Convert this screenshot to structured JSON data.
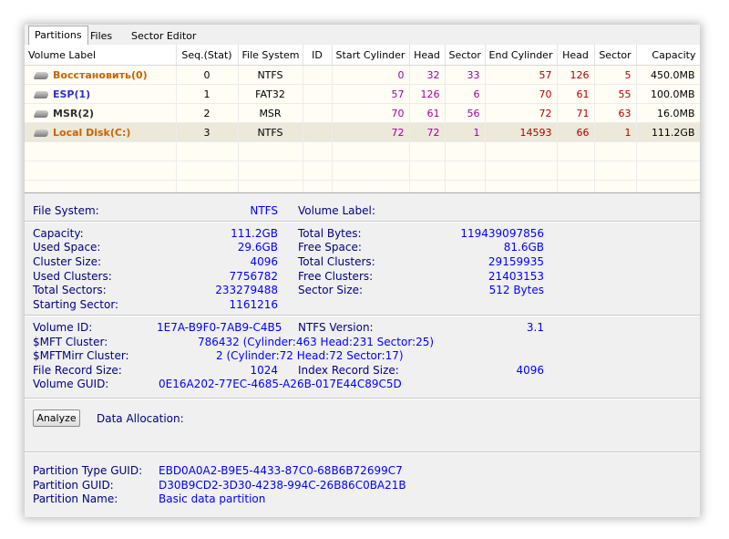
{
  "tabs": [
    "Partitions",
    "Files",
    "Sector Editor"
  ],
  "columns": [
    "Volume Label",
    "Seq.(Stat)",
    "File System",
    "ID",
    "Start Cylinder",
    "Head",
    "Sector",
    "End Cylinder",
    "Head",
    "Sector",
    "Capacity"
  ],
  "rows": [
    {
      "label": "Восстановить(0)",
      "seq": "0",
      "fs": "NTFS",
      "id": "",
      "start_cyl": "0",
      "head1": "32",
      "sector1": "33",
      "end_cyl": "57",
      "head2": "126",
      "sector2": "5",
      "capacity": "450.0MB"
    },
    {
      "label": "ESP(1)",
      "seq": "1",
      "fs": "FAT32",
      "id": "",
      "start_cyl": "57",
      "head1": "126",
      "sector1": "6",
      "end_cyl": "70",
      "head2": "61",
      "sector2": "55",
      "capacity": "100.0MB"
    },
    {
      "label": "MSR(2)",
      "seq": "2",
      "fs": "MSR",
      "id": "",
      "start_cyl": "70",
      "head1": "61",
      "sector1": "56",
      "end_cyl": "72",
      "head2": "71",
      "sector2": "63",
      "capacity": "16.0MB"
    },
    {
      "label": "Local Disk(C:)",
      "seq": "3",
      "fs": "NTFS",
      "id": "",
      "start_cyl": "72",
      "head1": "72",
      "sector1": "1",
      "end_cyl": "14593",
      "head2": "66",
      "sector2": "1",
      "capacity": "111.2GB"
    }
  ],
  "info": {
    "file_system_label": "File System:",
    "file_system": "NTFS",
    "volume_label_label": "Volume Label:",
    "capacity_label": "Capacity:",
    "capacity": "111.2GB",
    "used_space_label": "Used Space:",
    "used_space": "29.6GB",
    "cluster_size_label": "Cluster Size:",
    "cluster_size": "4096",
    "used_clusters_label": "Used Clusters:",
    "used_clusters": "7756782",
    "total_sectors_label": "Total Sectors:",
    "total_sectors": "233279488",
    "starting_sector_label": "Starting Sector:",
    "starting_sector": "1161216",
    "total_bytes_label": "Total Bytes:",
    "total_bytes": "119439097856",
    "free_space_label": "Free Space:",
    "free_space": "81.6GB",
    "total_clusters_label": "Total Clusters:",
    "total_clusters": "29159935",
    "free_clusters_label": "Free Clusters:",
    "free_clusters": "21403153",
    "sector_size_label": "Sector Size:",
    "sector_size": "512 Bytes",
    "volume_id_label": "Volume ID:",
    "volume_id": "1E7A-B9F0-7AB9-C4B5",
    "ntfs_version_label": "NTFS Version:",
    "ntfs_version": "3.1",
    "mft_cluster_label": "$MFT Cluster:",
    "mft_cluster": "786432 (Cylinder:463 Head:231 Sector:25)",
    "mftmirr_cluster_label": "$MFTMirr Cluster:",
    "mftmirr_cluster": "2 (Cylinder:72 Head:72 Sector:17)",
    "file_record_size_label": "File Record Size:",
    "file_record_size": "1024",
    "index_record_size_label": "Index Record Size:",
    "index_record_size": "4096",
    "volume_guid_label": "Volume GUID:",
    "volume_guid": "0E16A202-77EC-4685-A26B-017E44C89C5D"
  },
  "analyze_button": "Analyze",
  "data_allocation_label": "Data Allocation:",
  "partition": {
    "type_guid_label": "Partition Type GUID:",
    "type_guid": "EBD0A0A2-B9E5-4433-87C0-68B6B72699C7",
    "guid_label": "Partition GUID:",
    "guid": "D30B9CD2-3D30-4238-994C-26B86C0BA21B",
    "name_label": "Partition Name:",
    "name": "Basic data partition"
  }
}
